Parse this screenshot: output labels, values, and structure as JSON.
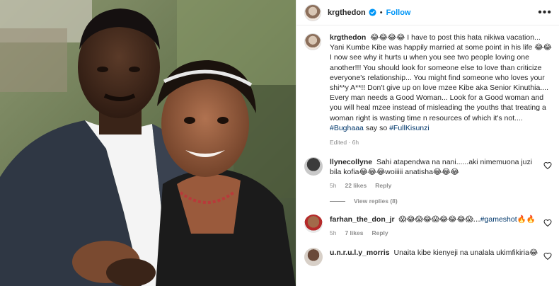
{
  "post": {
    "username": "krgthedon",
    "separator": "•",
    "follow_label": "Follow",
    "more_label": "•••",
    "caption_emojis": "😂😂😂😂",
    "caption_text": "I have to post this hata nikiwa vacation... Yani Kumbe Kibe was happily married at some point in his life 😂😂 I now see why it hurts u when you see two people loving one another!!! You should look for someone else to love than criticize everyone's relationship... You might find someone who loves your shi**y A**!! Don't give up on love mzee Kibe aka Senior Kinuthia.... Every man needs a Good Woman... Look for a Good woman and you will heal mzee instead of misleading the youths that treating a woman right is wasting time n resources of which it's not....",
    "hashtag_1": "#Bughaaa",
    "hashtag_mid": "say so",
    "hashtag_2": "#FullKisunzi",
    "meta": "Edited · 6h"
  },
  "comments": [
    {
      "username": "llynecollyne",
      "text": "Sahi atapendwa na nani......aki nimemuona juzi bila kofia😂😂😂woiiiii anatisha😂😂😂",
      "time": "5h",
      "likes": "22 likes",
      "reply": "Reply",
      "view_replies": "View replies (8)"
    },
    {
      "username": "farhan_the_don_jr",
      "text": "😱😂😱😂😱😂😂😂😱...",
      "hashtag": "#gameshot",
      "tail": "🔥🔥",
      "time": "5h",
      "likes": "7 likes",
      "reply": "Reply"
    },
    {
      "username": "u.n.r.u.l.y_morris",
      "text": "Unaita kibe kienyeji na unalala ukimfikiria😂"
    }
  ],
  "colors": {
    "link_blue": "#0095f6",
    "hashtag": "#00376b",
    "muted": "#8e8e8e"
  }
}
